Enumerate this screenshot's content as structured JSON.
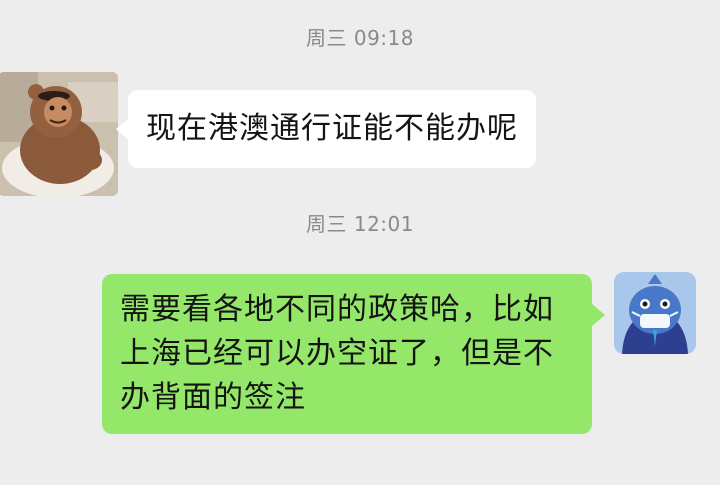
{
  "messages": [
    {
      "timestamp": "周三 09:18",
      "sender": "contact",
      "avatar": "bear-cartoon-avatar",
      "text": "现在港澳通行证能不能办呢"
    },
    {
      "timestamp": "周三 12:01",
      "sender": "self",
      "avatar": "blue-shark-avatar",
      "lines": [
        "需要看各地不同的政策哈，比如",
        "上海已经可以办空证了，但是不",
        "办背面的签注"
      ]
    }
  ],
  "colors": {
    "background": "#ededed",
    "incoming_bubble": "#ffffff",
    "outgoing_bubble": "#94e769",
    "timestamp_text": "#8a8a8a"
  }
}
